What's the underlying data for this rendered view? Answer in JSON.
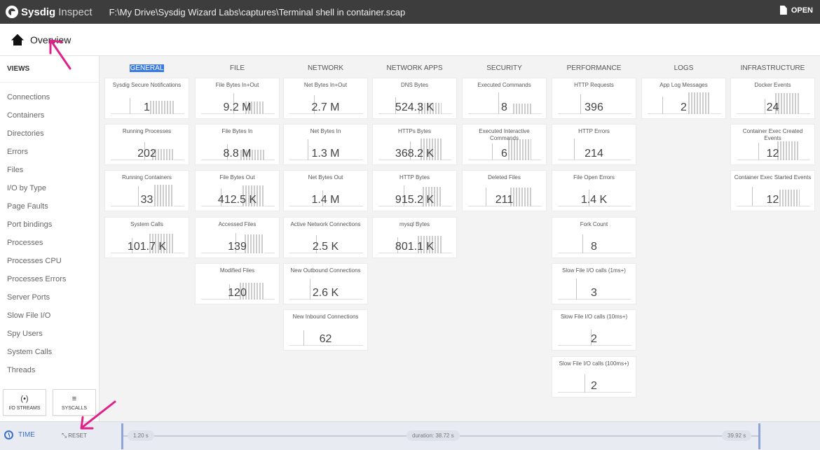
{
  "app": {
    "brand": "Sysdig",
    "product": "Inspect",
    "file_path": "F:\\My Drive\\Sysdig Wizard Labs\\captures\\Terminal shell in container.scap",
    "open_label": "OPEN"
  },
  "breadcrumb": {
    "title": "Overview"
  },
  "sidebar": {
    "header": "VIEWS",
    "items": [
      "Connections",
      "Containers",
      "Directories",
      "Errors",
      "Files",
      "I/O by Type",
      "Page Faults",
      "Port bindings",
      "Processes",
      "Processes CPU",
      "Processes Errors",
      "Server Ports",
      "Slow File I/O",
      "Spy Users",
      "System Calls",
      "Threads"
    ],
    "buttons": {
      "io_streams": "I/O STREAMS",
      "syscalls": "SYSCALLS"
    }
  },
  "columns": [
    {
      "title": "GENERAL",
      "selected": true,
      "tiles": [
        {
          "label": "Sysdig Secure Notifications",
          "value": "1"
        },
        {
          "label": "Running Processes",
          "value": "202"
        },
        {
          "label": "Running Containers",
          "value": "33"
        },
        {
          "label": "System Calls",
          "value": "101.7 K"
        }
      ]
    },
    {
      "title": "FILE",
      "tiles": [
        {
          "label": "File Bytes In+Out",
          "value": "9.2 M"
        },
        {
          "label": "File Bytes In",
          "value": "8.8 M"
        },
        {
          "label": "File Bytes Out",
          "value": "412.5 K"
        },
        {
          "label": "Accessed Files",
          "value": "139"
        },
        {
          "label": "Modified Files",
          "value": "120"
        }
      ]
    },
    {
      "title": "NETWORK",
      "tiles": [
        {
          "label": "Net Bytes In+Out",
          "value": "2.7 M"
        },
        {
          "label": "Net Bytes In",
          "value": "1.3 M"
        },
        {
          "label": "Net Bytes Out",
          "value": "1.4 M"
        },
        {
          "label": "Active Network Connections",
          "value": "2.5 K"
        },
        {
          "label": "New Outbound Connections",
          "value": "2.6 K"
        },
        {
          "label": "New Inbound Connections",
          "value": "62"
        }
      ]
    },
    {
      "title": "NETWORK APPS",
      "tiles": [
        {
          "label": "DNS Bytes",
          "value": "524.3 K"
        },
        {
          "label": "HTTPs Bytes",
          "value": "368.2 K"
        },
        {
          "label": "HTTP Bytes",
          "value": "915.2 K"
        },
        {
          "label": "mysql Bytes",
          "value": "801.1 K"
        }
      ]
    },
    {
      "title": "SECURITY",
      "tiles": [
        {
          "label": "Executed Commands",
          "value": "8"
        },
        {
          "label": "Executed Interactive Commands",
          "value": "6"
        },
        {
          "label": "Deleted Files",
          "value": "211"
        }
      ]
    },
    {
      "title": "PERFORMANCE",
      "tiles": [
        {
          "label": "HTTP Requests",
          "value": "396"
        },
        {
          "label": "HTTP Errors",
          "value": "214"
        },
        {
          "label": "File Open Errors",
          "value": "1.4 K"
        },
        {
          "label": "Fork Count",
          "value": "8"
        },
        {
          "label": "Slow File I/O calls (1ms+)",
          "value": "3"
        },
        {
          "label": "Slow File I/O calls (10ms+)",
          "value": "2"
        },
        {
          "label": "Slow File I/O calls (100ms+)",
          "value": "2"
        }
      ]
    },
    {
      "title": "LOGS",
      "tiles": [
        {
          "label": "App Log Messages",
          "value": "2"
        }
      ]
    },
    {
      "title": "INFRASTRUCTURE",
      "tiles": [
        {
          "label": "Docker Events",
          "value": "24"
        },
        {
          "label": "Container Exec Created Events",
          "value": "12"
        },
        {
          "label": "Container Exec Started Events",
          "value": "12"
        }
      ]
    }
  ],
  "timeline": {
    "time_label": "TIME",
    "reset_label": "RESET",
    "start": "1.20 s",
    "duration": "duration: 38.72 s",
    "end": "39.92 s"
  },
  "colors": {
    "accent": "#3b6fcc",
    "annotation": "#e0218a",
    "selection": "#3a7be3",
    "titlebar": "#3d3d3d"
  }
}
